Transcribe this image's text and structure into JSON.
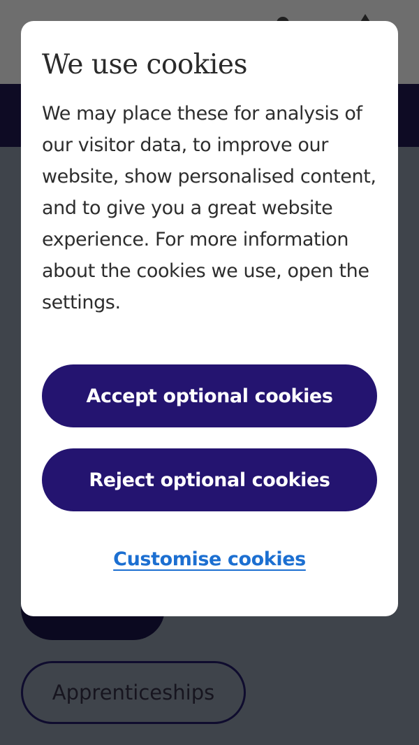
{
  "background": {
    "apprenticeships_label": "Apprenticeships"
  },
  "cookie_dialog": {
    "title": "We use cookies",
    "body": "We may place these for analysis of our visitor data, to improve our website, show personalised content, and to give you a great website experience. For more information about the cookies we use, open the settings.",
    "accept_label": "Accept optional cookies",
    "reject_label": "Reject optional cookies",
    "customise_label": "Customise cookies"
  },
  "colors": {
    "primary_button": "#241470",
    "link": "#1c6fd1",
    "overlay_dim": "#3f444b",
    "nav_dark": "#0e0b24"
  }
}
